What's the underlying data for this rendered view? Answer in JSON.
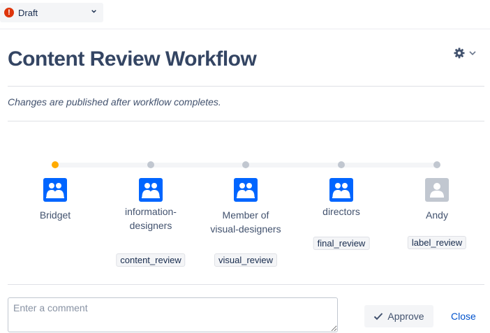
{
  "status": {
    "label": "Draft",
    "status_icon": "error-icon",
    "status_color": "#de350b"
  },
  "header": {
    "title": "Content Review Workflow",
    "settings_icon": "gear-icon"
  },
  "subtitle": "Changes are published after workflow completes.",
  "workflow": {
    "steps": [
      {
        "name": "Bridget",
        "type": "group",
        "active": true,
        "tag": ""
      },
      {
        "name": "information-designers",
        "name_lines": [
          "information-",
          "designers"
        ],
        "type": "group",
        "active": false,
        "tag": "content_review"
      },
      {
        "name": "Member of visual-designers",
        "name_lines": [
          "Member of",
          "visual-designers"
        ],
        "type": "group",
        "active": false,
        "tag": "visual_review"
      },
      {
        "name": "directors",
        "type": "group",
        "active": false,
        "tag": "final_review"
      },
      {
        "name": "Andy",
        "type": "user",
        "active": false,
        "tag": "label_review"
      }
    ]
  },
  "footer": {
    "comment_placeholder": "Enter a comment",
    "comment_value": "",
    "approve_label": "Approve",
    "close_label": "Close"
  },
  "colors": {
    "accent": "#0065ff",
    "active_step": "#ffab00",
    "inactive_step": "#c1c7d0",
    "link": "#0052cc"
  }
}
